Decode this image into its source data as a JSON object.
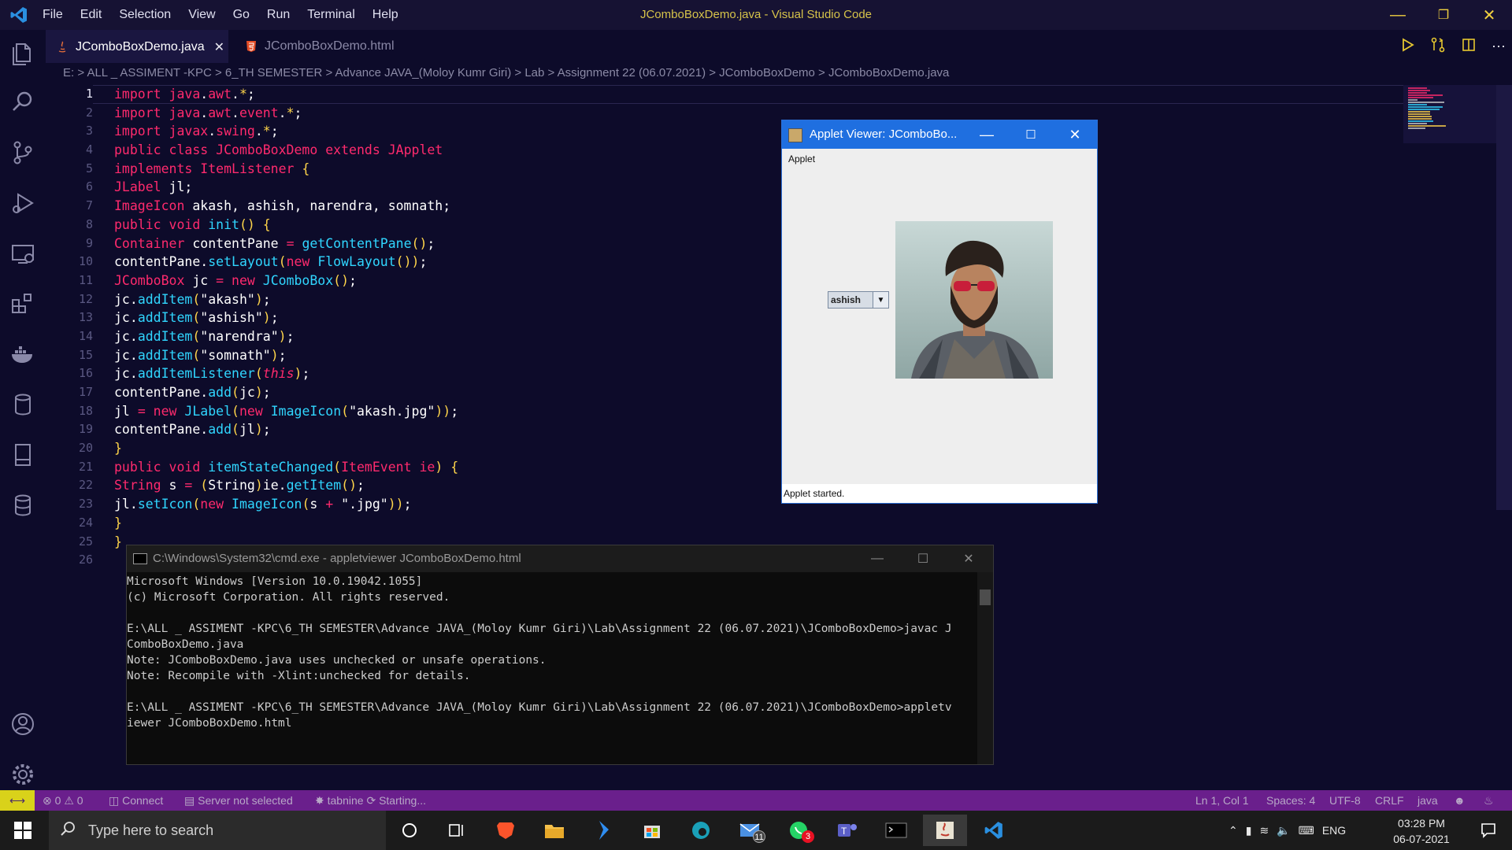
{
  "window": {
    "title": "JComboBoxDemo.java - Visual Studio Code",
    "menu": [
      "File",
      "Edit",
      "Selection",
      "View",
      "Go",
      "Run",
      "Terminal",
      "Help"
    ]
  },
  "tabs": [
    {
      "label": "JComboBoxDemo.java",
      "active": true
    },
    {
      "label": "JComboBoxDemo.html",
      "active": false
    }
  ],
  "breadcrumb": "E: > ALL _ ASSIMENT -KPC > 6_TH SEMESTER > Advance JAVA_(Moloy Kumr Giri) > Lab > Assignment 22 (06.07.2021) > JComboBoxDemo > JComboBoxDemo.java",
  "editor": {
    "line_numbers": [
      "1",
      "2",
      "3",
      "4",
      "5",
      "6",
      "7",
      "8",
      "9",
      "10",
      "11",
      "12",
      "13",
      "14",
      "15",
      "16",
      "17",
      "18",
      "19",
      "20",
      "21",
      "22",
      "23",
      "24",
      "25",
      "26"
    ],
    "current_line": 1
  },
  "applet": {
    "title": "Applet Viewer: JComboBo...",
    "menu": "Applet",
    "combo_value": "ashish",
    "status": "Applet started."
  },
  "cmd": {
    "title": "C:\\Windows\\System32\\cmd.exe - appletviewer  JComboBoxDemo.html",
    "lines": [
      "Microsoft Windows [Version 10.0.19042.1055]",
      "(c) Microsoft Corporation. All rights reserved.",
      "",
      "E:\\ALL _ ASSIMENT -KPC\\6_TH SEMESTER\\Advance JAVA_(Moloy Kumr Giri)\\Lab\\Assignment 22 (06.07.2021)\\JComboBoxDemo>javac J",
      "ComboBoxDemo.java",
      "Note: JComboBoxDemo.java uses unchecked or unsafe operations.",
      "Note: Recompile with -Xlint:unchecked for details.",
      "",
      "E:\\ALL _ ASSIMENT -KPC\\6_TH SEMESTER\\Advance JAVA_(Moloy Kumr Giri)\\Lab\\Assignment 22 (06.07.2021)\\JComboBoxDemo>appletv",
      "iewer JComboBoxDemo.html"
    ]
  },
  "statusbar": {
    "errors": "0",
    "warnings": "0",
    "connect": "Connect",
    "server": "Server not selected",
    "tabnine": "tabnine",
    "starting": "Starting...",
    "position": "Ln 1, Col 1",
    "spaces": "Spaces: 4",
    "encoding": "UTF-8",
    "eol": "CRLF",
    "language": "java"
  },
  "taskbar": {
    "search_placeholder": "Type here to search",
    "mail_badge": "11",
    "whatsapp_badge": "3",
    "language": "ENG",
    "time": "03:28 PM",
    "date": "06-07-2021"
  },
  "colors": {
    "editor_bg": "#0d0b2a",
    "keyword": "#ff2a6d",
    "function": "#30d6ff",
    "string": "#ffd54a",
    "statusbar": "#6a1f8c",
    "applet_titlebar": "#1f6fe0"
  }
}
